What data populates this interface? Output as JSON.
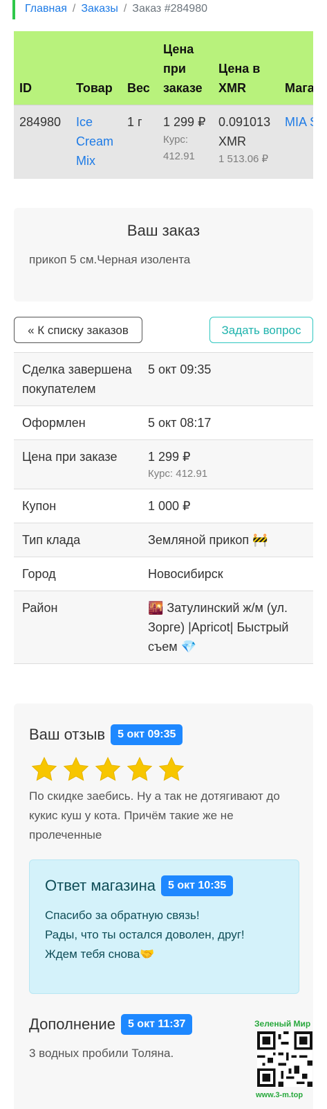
{
  "breadcrumb": {
    "home": "Главная",
    "sep": "/",
    "orders": "Заказы",
    "current": "Заказ #284980"
  },
  "order_table": {
    "headers": [
      "ID",
      "Товар",
      "Вес",
      "Цена при заказе",
      "Цена в XMR",
      "Магазин"
    ],
    "row": {
      "id": "284980",
      "product": "Ice Cream Mix",
      "weight": "1 г",
      "price": "1 299 ₽",
      "price_rate": "Курс: 412.91",
      "xmr_price": "0.091013 XMR",
      "xmr_rub": "1 513.06 ₽",
      "shop": "MIA SHOP"
    }
  },
  "order_card": {
    "title": "Ваш заказ",
    "note": "прикоп 5 см.Черная изолента"
  },
  "buttons": {
    "back": "« К списку заказов",
    "ask": "Задать вопрос"
  },
  "details": [
    {
      "label": "Сделка завершена покупателем",
      "value": "5 окт 09:35"
    },
    {
      "label": "Оформлен",
      "value": "5 окт 08:17"
    },
    {
      "label": "Цена при заказе",
      "value": "1 299 ₽",
      "sub": "Курс: 412.91"
    },
    {
      "label": "Купон",
      "value": "1 000 ₽"
    },
    {
      "label": "Тип клада",
      "value": "Земляной прикоп 🚧"
    },
    {
      "label": "Город",
      "value": "Новосибирск"
    },
    {
      "label": "Район",
      "value": "🌇 Затулинский ж/м (ул. Зорге) |Apricot| Быстрый съем 💎"
    }
  ],
  "review": {
    "title": "Ваш отзыв",
    "time": "5 окт 09:35",
    "rating": 5,
    "rating_max": 5,
    "text": "По скидке заебись. Ну а так не дотягивают до кукис куш у кота. Причём такие же не пролеченные"
  },
  "shop_reply": {
    "title": "Ответ магазина",
    "time": "5 окт 10:35",
    "line1": "Спасибо за обратную связь!",
    "line2": "Рады, что ты остался доволен, друг!",
    "line3": "Ждем тебя снова🤝"
  },
  "addition": {
    "title": "Дополнение",
    "time": "5 окт 11:37",
    "text": "3 водных пробили Толяна."
  },
  "watermark": {
    "top": "Зеленый Мир",
    "bottom": "www.3-m.top"
  },
  "colors": {
    "accent_green": "#b8f27c",
    "link_blue": "#1e7be6",
    "badge_blue": "#1e88ff",
    "teal": "#2ec7c0",
    "star": "#f7c600"
  }
}
